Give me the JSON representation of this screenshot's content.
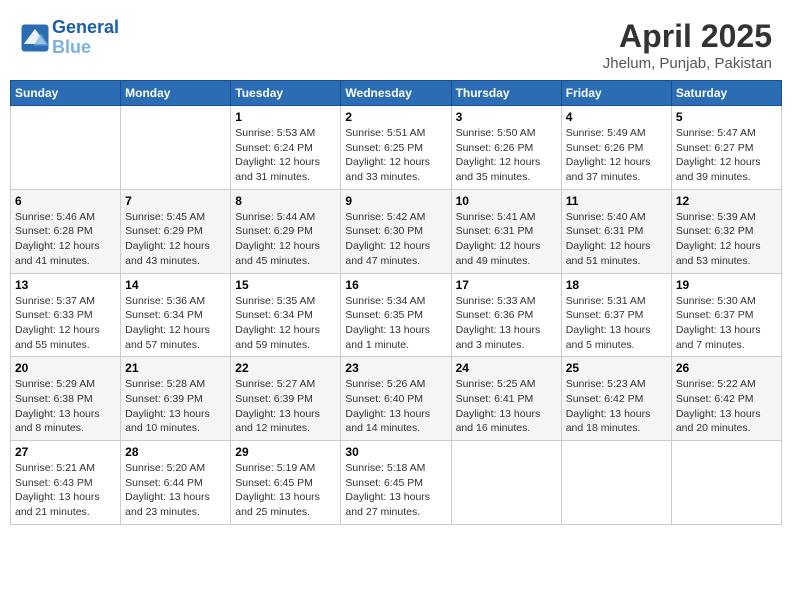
{
  "header": {
    "logo_line1": "General",
    "logo_line2": "Blue",
    "month": "April 2025",
    "location": "Jhelum, Punjab, Pakistan"
  },
  "weekdays": [
    "Sunday",
    "Monday",
    "Tuesday",
    "Wednesday",
    "Thursday",
    "Friday",
    "Saturday"
  ],
  "weeks": [
    [
      {
        "day": "",
        "info": ""
      },
      {
        "day": "",
        "info": ""
      },
      {
        "day": "1",
        "info": "Sunrise: 5:53 AM\nSunset: 6:24 PM\nDaylight: 12 hours and 31 minutes."
      },
      {
        "day": "2",
        "info": "Sunrise: 5:51 AM\nSunset: 6:25 PM\nDaylight: 12 hours and 33 minutes."
      },
      {
        "day": "3",
        "info": "Sunrise: 5:50 AM\nSunset: 6:26 PM\nDaylight: 12 hours and 35 minutes."
      },
      {
        "day": "4",
        "info": "Sunrise: 5:49 AM\nSunset: 6:26 PM\nDaylight: 12 hours and 37 minutes."
      },
      {
        "day": "5",
        "info": "Sunrise: 5:47 AM\nSunset: 6:27 PM\nDaylight: 12 hours and 39 minutes."
      }
    ],
    [
      {
        "day": "6",
        "info": "Sunrise: 5:46 AM\nSunset: 6:28 PM\nDaylight: 12 hours and 41 minutes."
      },
      {
        "day": "7",
        "info": "Sunrise: 5:45 AM\nSunset: 6:29 PM\nDaylight: 12 hours and 43 minutes."
      },
      {
        "day": "8",
        "info": "Sunrise: 5:44 AM\nSunset: 6:29 PM\nDaylight: 12 hours and 45 minutes."
      },
      {
        "day": "9",
        "info": "Sunrise: 5:42 AM\nSunset: 6:30 PM\nDaylight: 12 hours and 47 minutes."
      },
      {
        "day": "10",
        "info": "Sunrise: 5:41 AM\nSunset: 6:31 PM\nDaylight: 12 hours and 49 minutes."
      },
      {
        "day": "11",
        "info": "Sunrise: 5:40 AM\nSunset: 6:31 PM\nDaylight: 12 hours and 51 minutes."
      },
      {
        "day": "12",
        "info": "Sunrise: 5:39 AM\nSunset: 6:32 PM\nDaylight: 12 hours and 53 minutes."
      }
    ],
    [
      {
        "day": "13",
        "info": "Sunrise: 5:37 AM\nSunset: 6:33 PM\nDaylight: 12 hours and 55 minutes."
      },
      {
        "day": "14",
        "info": "Sunrise: 5:36 AM\nSunset: 6:34 PM\nDaylight: 12 hours and 57 minutes."
      },
      {
        "day": "15",
        "info": "Sunrise: 5:35 AM\nSunset: 6:34 PM\nDaylight: 12 hours and 59 minutes."
      },
      {
        "day": "16",
        "info": "Sunrise: 5:34 AM\nSunset: 6:35 PM\nDaylight: 13 hours and 1 minute."
      },
      {
        "day": "17",
        "info": "Sunrise: 5:33 AM\nSunset: 6:36 PM\nDaylight: 13 hours and 3 minutes."
      },
      {
        "day": "18",
        "info": "Sunrise: 5:31 AM\nSunset: 6:37 PM\nDaylight: 13 hours and 5 minutes."
      },
      {
        "day": "19",
        "info": "Sunrise: 5:30 AM\nSunset: 6:37 PM\nDaylight: 13 hours and 7 minutes."
      }
    ],
    [
      {
        "day": "20",
        "info": "Sunrise: 5:29 AM\nSunset: 6:38 PM\nDaylight: 13 hours and 8 minutes."
      },
      {
        "day": "21",
        "info": "Sunrise: 5:28 AM\nSunset: 6:39 PM\nDaylight: 13 hours and 10 minutes."
      },
      {
        "day": "22",
        "info": "Sunrise: 5:27 AM\nSunset: 6:39 PM\nDaylight: 13 hours and 12 minutes."
      },
      {
        "day": "23",
        "info": "Sunrise: 5:26 AM\nSunset: 6:40 PM\nDaylight: 13 hours and 14 minutes."
      },
      {
        "day": "24",
        "info": "Sunrise: 5:25 AM\nSunset: 6:41 PM\nDaylight: 13 hours and 16 minutes."
      },
      {
        "day": "25",
        "info": "Sunrise: 5:23 AM\nSunset: 6:42 PM\nDaylight: 13 hours and 18 minutes."
      },
      {
        "day": "26",
        "info": "Sunrise: 5:22 AM\nSunset: 6:42 PM\nDaylight: 13 hours and 20 minutes."
      }
    ],
    [
      {
        "day": "27",
        "info": "Sunrise: 5:21 AM\nSunset: 6:43 PM\nDaylight: 13 hours and 21 minutes."
      },
      {
        "day": "28",
        "info": "Sunrise: 5:20 AM\nSunset: 6:44 PM\nDaylight: 13 hours and 23 minutes."
      },
      {
        "day": "29",
        "info": "Sunrise: 5:19 AM\nSunset: 6:45 PM\nDaylight: 13 hours and 25 minutes."
      },
      {
        "day": "30",
        "info": "Sunrise: 5:18 AM\nSunset: 6:45 PM\nDaylight: 13 hours and 27 minutes."
      },
      {
        "day": "",
        "info": ""
      },
      {
        "day": "",
        "info": ""
      },
      {
        "day": "",
        "info": ""
      }
    ]
  ]
}
